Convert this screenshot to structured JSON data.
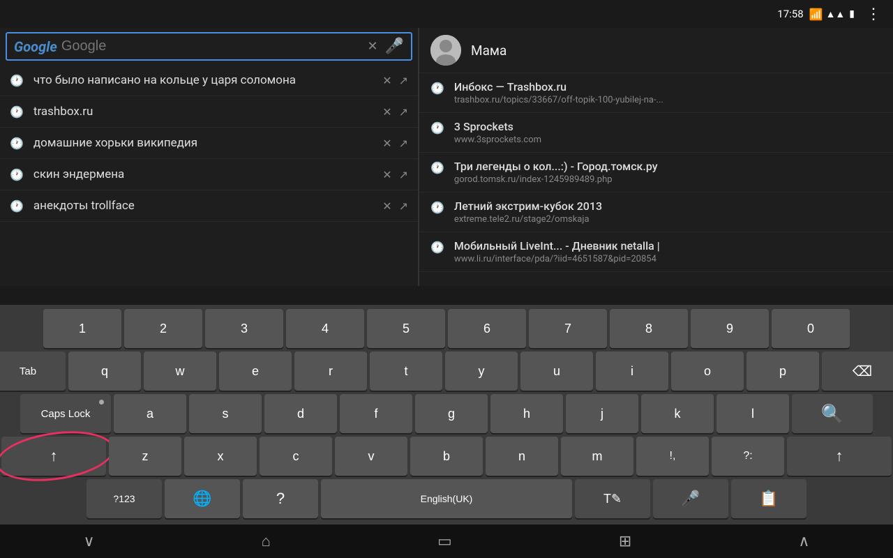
{
  "topbar": {
    "menu_dots": "⋮"
  },
  "search": {
    "placeholder": "Google",
    "value": "",
    "logo": "Google"
  },
  "suggestions": [
    {
      "text": "что было написано на кольце у царя соломона"
    },
    {
      "text": "trashbox.ru"
    },
    {
      "text": "домашние хорьки википедия"
    },
    {
      "text": "скин эндермена"
    },
    {
      "text": "анекдоты trollface"
    }
  ],
  "contact": {
    "name": "Мама"
  },
  "history": [
    {
      "title": "Инбокс — Trashbox.ru",
      "url": "trashbox.ru/topics/33667/off-topik-100-yubilej-na-..."
    },
    {
      "title": "3 Sprockets",
      "url": "www.3sprockets.com"
    },
    {
      "title": "Три легенды о кол...:) - Город.томск.ру",
      "url": "gorod.tomsk.ru/index-1245989489.php"
    },
    {
      "title": "Летний экстрим-кубок 2013",
      "url": "extreme.tele2.ru/stage2/omskaja"
    },
    {
      "title": "Мобильный LiveInt... - Дневник netalla |",
      "url": "www.li.ru/interface/pda/?iid=4651587&pid=20854"
    }
  ],
  "keyboard": {
    "rows": {
      "numbers": [
        "1",
        "2",
        "3",
        "4",
        "5",
        "6",
        "7",
        "8",
        "9",
        "0"
      ],
      "row1": [
        "q",
        "w",
        "e",
        "r",
        "t",
        "y",
        "u",
        "i",
        "o",
        "p"
      ],
      "row2": [
        "a",
        "s",
        "d",
        "f",
        "g",
        "h",
        "j",
        "k",
        "l"
      ],
      "row3": [
        "z",
        "x",
        "c",
        "v",
        "b",
        "n",
        "m",
        "!,",
        "?:"
      ]
    },
    "special": {
      "tab": "Tab",
      "caps": "Caps Lock",
      "shift_left": "↑",
      "shift_right": "↑",
      "backspace": "⌫",
      "search_enter": "🔍",
      "num_switch": "?123",
      "globe": "🌐",
      "question": "?",
      "space": "English(UK)",
      "lang": "T✎",
      "mic": "🎤",
      "clipboard": "📋"
    }
  },
  "statusbar": {
    "time": "17:58",
    "wifi": "wifi",
    "signal": "signal",
    "battery": "battery"
  },
  "navbar": {
    "back": "∨",
    "home": "⌂",
    "recents": "▭",
    "qr": "⊞",
    "up": "∧"
  }
}
